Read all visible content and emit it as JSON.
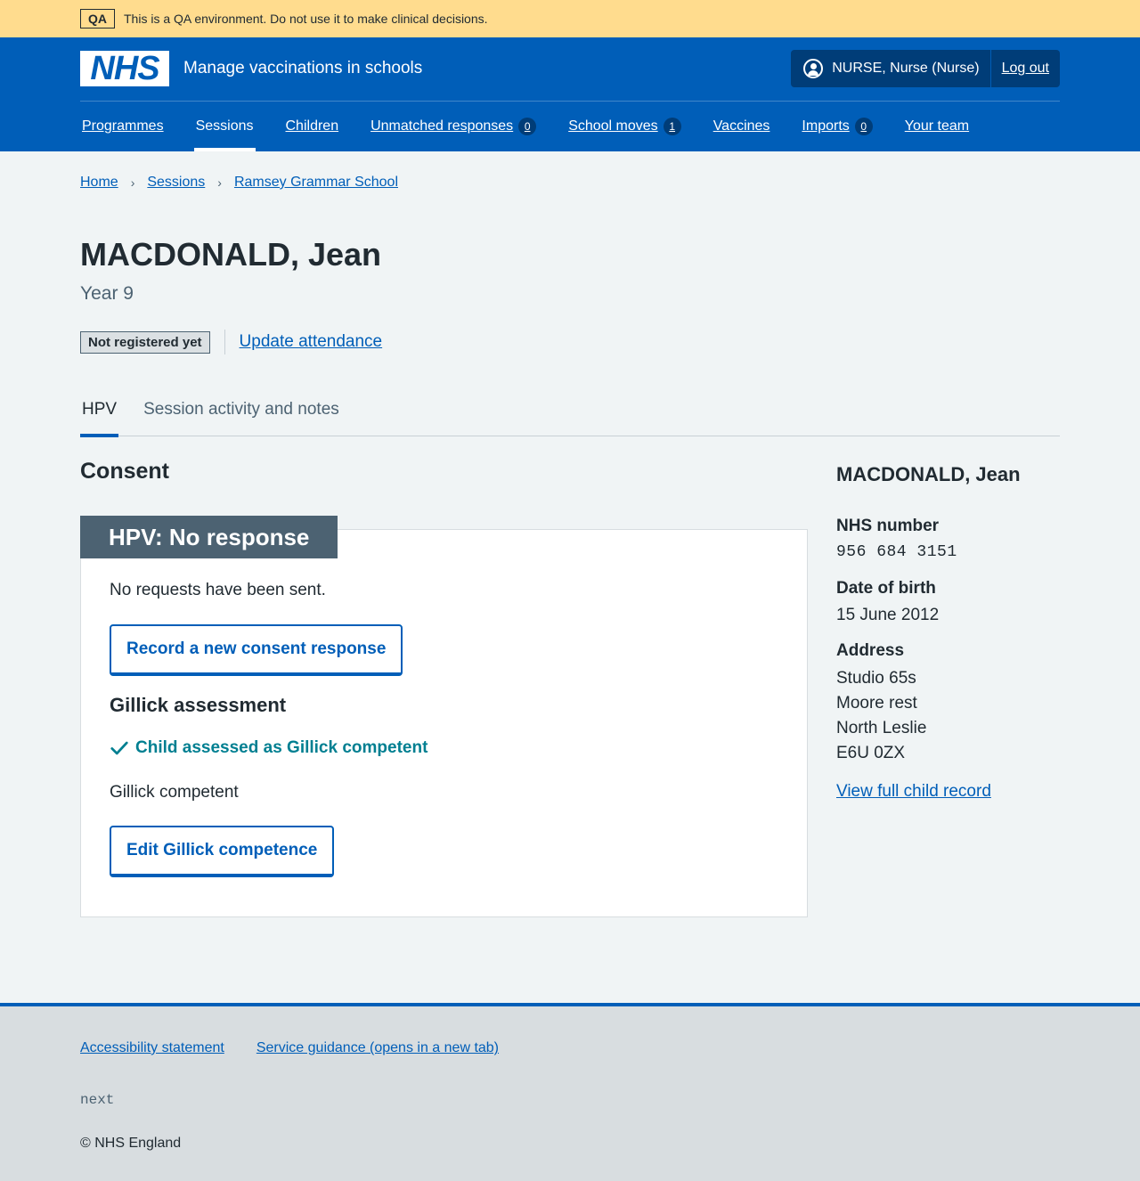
{
  "qa_banner": {
    "tag": "QA",
    "message": "This is a QA environment. Do not use it to make clinical decisions."
  },
  "header": {
    "logo_text": "NHS",
    "service_name": "Manage vaccinations in schools",
    "user": "NURSE, Nurse (Nurse)",
    "logout": "Log out",
    "user_icon": "user-circle-icon"
  },
  "nav": {
    "items": [
      {
        "label": "Programmes"
      },
      {
        "label": "Sessions",
        "active": true
      },
      {
        "label": "Children"
      },
      {
        "label": "Unmatched responses",
        "count": "0"
      },
      {
        "label": "School moves",
        "count": "1"
      },
      {
        "label": "Vaccines"
      },
      {
        "label": "Imports",
        "count": "0"
      },
      {
        "label": "Your team"
      }
    ]
  },
  "breadcrumb": [
    "Home",
    "Sessions",
    "Ramsey Grammar School"
  ],
  "child": {
    "name": "MACDONALD, Jean",
    "year": "Year 9",
    "registration_status": "Not registered yet",
    "update_attendance": "Update attendance"
  },
  "tabs": [
    {
      "label": "HPV",
      "active": true
    },
    {
      "label": "Session activity and notes"
    }
  ],
  "consent": {
    "heading": "Consent",
    "card_title": "HPV: No response",
    "requests_text": "No requests have been sent.",
    "record_button": "Record a new consent response",
    "gillick_heading": "Gillick assessment",
    "gillick_status": "Child assessed as Gillick competent",
    "gillick_text": "Gillick competent",
    "edit_button": "Edit Gillick competence",
    "status_icon": "tick-icon"
  },
  "aside": {
    "name": "MACDONALD, Jean",
    "nhs_number_label": "NHS number",
    "nhs_number": "956 684 3151",
    "dob_label": "Date of birth",
    "dob": "15 June 2012",
    "address_label": "Address",
    "address_lines": [
      "Studio 65s",
      "Moore rest",
      "North Leslie",
      "E6U 0ZX"
    ],
    "view_record": "View full child record"
  },
  "footer": {
    "links": [
      "Accessibility statement",
      "Service guidance (opens in a new tab)"
    ],
    "env": "next",
    "copyright": "© NHS England"
  },
  "colors": {
    "nhs_blue": "#005eb8",
    "qa_banner": "#ffdc8e",
    "card_heading": "#4c6272",
    "gillick_green": "#007f91",
    "page_bg": "#f0f4f5"
  }
}
